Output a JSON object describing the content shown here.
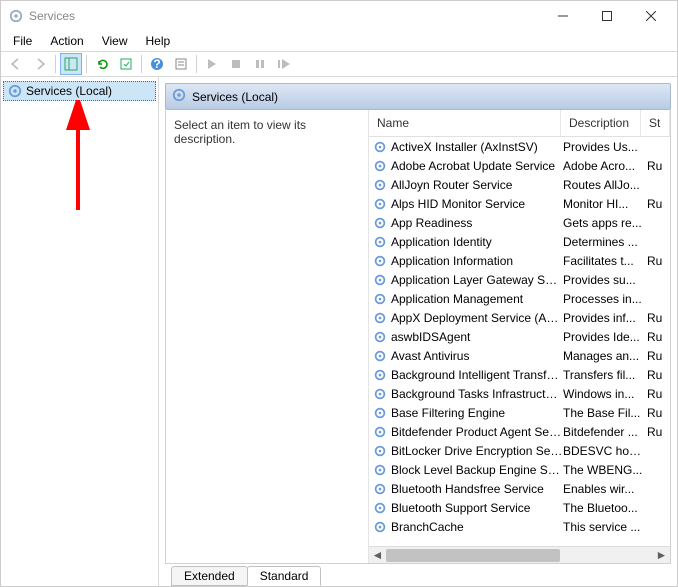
{
  "window": {
    "title": "Services"
  },
  "menubar": [
    "File",
    "Action",
    "View",
    "Help"
  ],
  "tree": {
    "root": "Services (Local)"
  },
  "panel": {
    "header": "Services (Local)",
    "desc_prompt": "Select an item to view its description."
  },
  "columns": {
    "name": "Name",
    "description": "Description",
    "status": "St"
  },
  "services": [
    {
      "name": "ActiveX Installer (AxInstSV)",
      "description": "Provides Us...",
      "status": ""
    },
    {
      "name": "Adobe Acrobat Update Service",
      "description": "Adobe Acro...",
      "status": "Ru"
    },
    {
      "name": "AllJoyn Router Service",
      "description": "Routes AllJo...",
      "status": ""
    },
    {
      "name": "Alps HID Monitor Service",
      "description": "Monitor HI...",
      "status": "Ru"
    },
    {
      "name": "App Readiness",
      "description": "Gets apps re...",
      "status": ""
    },
    {
      "name": "Application Identity",
      "description": "Determines ...",
      "status": ""
    },
    {
      "name": "Application Information",
      "description": "Facilitates t...",
      "status": "Ru"
    },
    {
      "name": "Application Layer Gateway Service",
      "description": "Provides su...",
      "status": ""
    },
    {
      "name": "Application Management",
      "description": "Processes in...",
      "status": ""
    },
    {
      "name": "AppX Deployment Service (AppXS...",
      "description": "Provides inf...",
      "status": "Ru"
    },
    {
      "name": "aswbIDSAgent",
      "description": "Provides Ide...",
      "status": "Ru"
    },
    {
      "name": "Avast Antivirus",
      "description": "Manages an...",
      "status": "Ru"
    },
    {
      "name": "Background Intelligent Transfer Ser...",
      "description": "Transfers fil...",
      "status": "Ru"
    },
    {
      "name": "Background Tasks Infrastructure Se...",
      "description": "Windows in...",
      "status": "Ru"
    },
    {
      "name": "Base Filtering Engine",
      "description": "The Base Fil...",
      "status": "Ru"
    },
    {
      "name": "Bitdefender Product Agent Service",
      "description": "Bitdefender ...",
      "status": "Ru"
    },
    {
      "name": "BitLocker Drive Encryption Service",
      "description": "BDESVC hos...",
      "status": ""
    },
    {
      "name": "Block Level Backup Engine Service",
      "description": "The WBENG...",
      "status": ""
    },
    {
      "name": "Bluetooth Handsfree Service",
      "description": "Enables wir...",
      "status": ""
    },
    {
      "name": "Bluetooth Support Service",
      "description": "The Bluetoo...",
      "status": ""
    },
    {
      "name": "BranchCache",
      "description": "This service ...",
      "status": ""
    }
  ],
  "tabs": {
    "extended": "Extended",
    "standard": "Standard"
  }
}
